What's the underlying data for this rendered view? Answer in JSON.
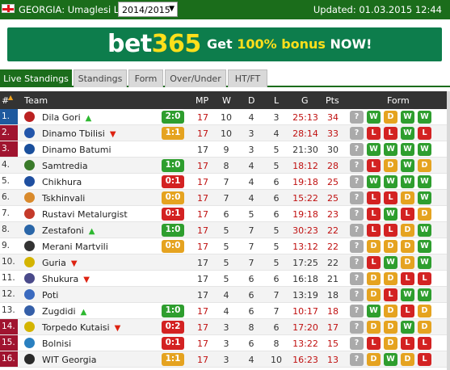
{
  "topbar": {
    "league": "GEORGIA: Umaglesi Liga",
    "season": "2014/2015",
    "updated": "Updated: 01.03.2015 12:44"
  },
  "banner": {
    "logo_a": "bet",
    "logo_b": "365",
    "promo_a": "Get ",
    "promo_b": "100% bonus",
    "promo_c": " NOW!"
  },
  "tabs": [
    "Live Standings",
    "Standings",
    "Form",
    "Over/Under",
    "HT/FT"
  ],
  "header": {
    "rank": "#",
    "team": "Team",
    "mp": "MP",
    "w": "W",
    "d": "D",
    "l": "L",
    "g": "G",
    "pts": "Pts",
    "form": "Form"
  },
  "colors": {
    "promo": "#2e7d32",
    "group_blue": "#1f5a9e",
    "group_red": "#a0142f",
    "win": "#2e9e2e",
    "draw": "#e5a320",
    "loss": "#d32222"
  },
  "rows": [
    {
      "rank": "1.",
      "team": "Dila Gori",
      "trend": "up",
      "live": "2:0",
      "live_result": "W",
      "mp": "17",
      "w": "10",
      "d": "4",
      "l": "3",
      "g": "25:13",
      "pts": "34",
      "form": [
        "W",
        "D",
        "W",
        "W"
      ],
      "rank_color": "blue"
    },
    {
      "rank": "2.",
      "team": "Dinamo Tbilisi",
      "trend": "down",
      "live": "1:1",
      "live_result": "D",
      "mp": "17",
      "w": "10",
      "d": "3",
      "l": "4",
      "g": "28:14",
      "pts": "33",
      "form": [
        "L",
        "L",
        "W",
        "L"
      ],
      "rank_color": "red"
    },
    {
      "rank": "3.",
      "team": "Dinamo Batumi",
      "trend": "",
      "live": "",
      "live_result": "",
      "mp": "17",
      "w": "9",
      "d": "3",
      "l": "5",
      "g": "21:30",
      "pts": "30",
      "form": [
        "W",
        "W",
        "W",
        "W"
      ],
      "rank_color": "red"
    },
    {
      "rank": "4.",
      "team": "Samtredia",
      "trend": "",
      "live": "1:0",
      "live_result": "W",
      "mp": "17",
      "w": "8",
      "d": "4",
      "l": "5",
      "g": "18:12",
      "pts": "28",
      "form": [
        "L",
        "D",
        "W",
        "D"
      ],
      "rank_color": ""
    },
    {
      "rank": "5.",
      "team": "Chikhura",
      "trend": "",
      "live": "0:1",
      "live_result": "L",
      "mp": "17",
      "w": "7",
      "d": "4",
      "l": "6",
      "g": "19:18",
      "pts": "25",
      "form": [
        "W",
        "W",
        "W",
        "W"
      ],
      "rank_color": ""
    },
    {
      "rank": "6.",
      "team": "Tskhinvali",
      "trend": "",
      "live": "0:0",
      "live_result": "D",
      "mp": "17",
      "w": "7",
      "d": "4",
      "l": "6",
      "g": "15:22",
      "pts": "25",
      "form": [
        "L",
        "L",
        "D",
        "W"
      ],
      "rank_color": ""
    },
    {
      "rank": "7.",
      "team": "Rustavi Metalurgist",
      "trend": "",
      "live": "0:1",
      "live_result": "L",
      "mp": "17",
      "w": "6",
      "d": "5",
      "l": "6",
      "g": "19:18",
      "pts": "23",
      "form": [
        "L",
        "W",
        "L",
        "D"
      ],
      "rank_color": ""
    },
    {
      "rank": "8.",
      "team": "Zestafoni",
      "trend": "up",
      "live": "1:0",
      "live_result": "W",
      "mp": "17",
      "w": "5",
      "d": "7",
      "l": "5",
      "g": "30:23",
      "pts": "22",
      "form": [
        "L",
        "L",
        "D",
        "W"
      ],
      "rank_color": ""
    },
    {
      "rank": "9.",
      "team": "Merani Martvili",
      "trend": "",
      "live": "0:0",
      "live_result": "D",
      "mp": "17",
      "w": "5",
      "d": "7",
      "l": "5",
      "g": "13:12",
      "pts": "22",
      "form": [
        "D",
        "D",
        "D",
        "W"
      ],
      "rank_color": ""
    },
    {
      "rank": "10.",
      "team": "Guria",
      "trend": "down",
      "live": "",
      "live_result": "",
      "mp": "17",
      "w": "5",
      "d": "7",
      "l": "5",
      "g": "17:25",
      "pts": "22",
      "form": [
        "L",
        "W",
        "D",
        "W"
      ],
      "rank_color": ""
    },
    {
      "rank": "11.",
      "team": "Shukura",
      "trend": "down",
      "live": "",
      "live_result": "",
      "mp": "17",
      "w": "5",
      "d": "6",
      "l": "6",
      "g": "16:18",
      "pts": "21",
      "form": [
        "D",
        "D",
        "L",
        "L"
      ],
      "rank_color": ""
    },
    {
      "rank": "12.",
      "team": "Poti",
      "trend": "",
      "live": "",
      "live_result": "",
      "mp": "17",
      "w": "4",
      "d": "6",
      "l": "7",
      "g": "13:19",
      "pts": "18",
      "form": [
        "D",
        "L",
        "W",
        "W"
      ],
      "rank_color": ""
    },
    {
      "rank": "13.",
      "team": "Zugdidi",
      "trend": "up",
      "live": "1:0",
      "live_result": "W",
      "mp": "17",
      "w": "4",
      "d": "6",
      "l": "7",
      "g": "10:17",
      "pts": "18",
      "form": [
        "W",
        "D",
        "L",
        "D"
      ],
      "rank_color": ""
    },
    {
      "rank": "14.",
      "team": "Torpedo Kutaisi",
      "trend": "down",
      "live": "0:2",
      "live_result": "L",
      "mp": "17",
      "w": "3",
      "d": "8",
      "l": "6",
      "g": "17:20",
      "pts": "17",
      "form": [
        "D",
        "D",
        "W",
        "D"
      ],
      "rank_color": "red"
    },
    {
      "rank": "15.",
      "team": "Bolnisi",
      "trend": "",
      "live": "0:1",
      "live_result": "L",
      "mp": "17",
      "w": "3",
      "d": "6",
      "l": "8",
      "g": "13:22",
      "pts": "15",
      "form": [
        "L",
        "D",
        "L",
        "L"
      ],
      "rank_color": "red"
    },
    {
      "rank": "16.",
      "team": "WIT Georgia",
      "trend": "",
      "live": "1:1",
      "live_result": "D",
      "mp": "17",
      "w": "3",
      "d": "4",
      "l": "10",
      "g": "16:23",
      "pts": "13",
      "form": [
        "D",
        "W",
        "D",
        "L"
      ],
      "rank_color": "red"
    }
  ]
}
